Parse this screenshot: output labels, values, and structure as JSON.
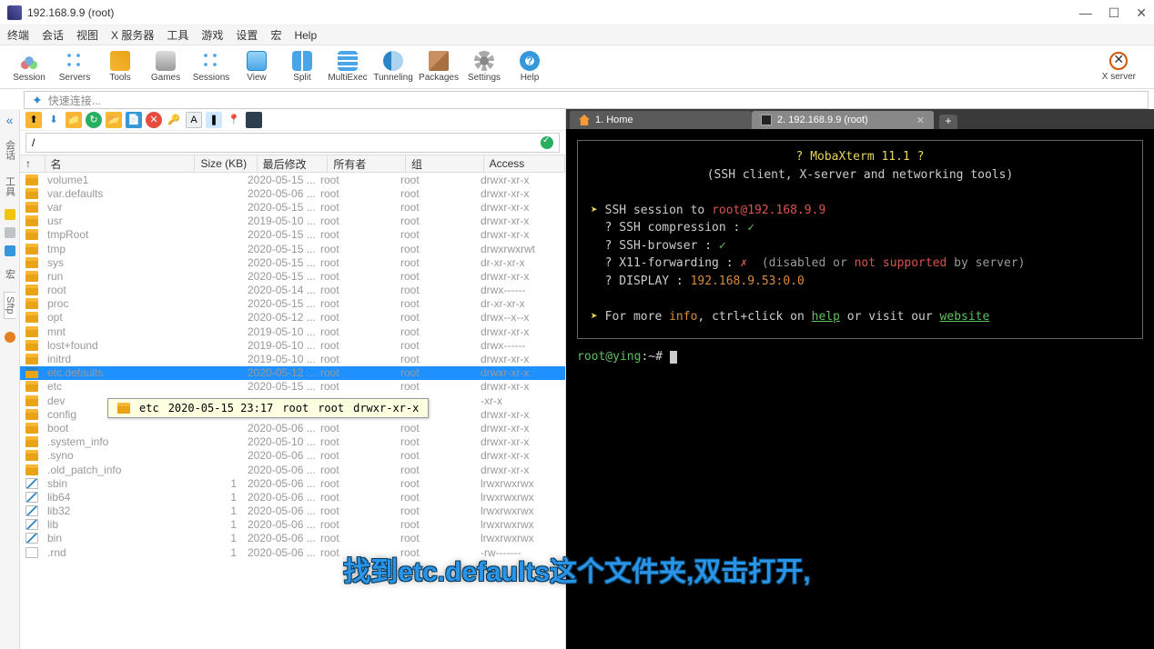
{
  "window": {
    "title": "192.168.9.9 (root)",
    "min": "—",
    "max": "☐",
    "close": "✕"
  },
  "menu": [
    "终端",
    "会话",
    "视图",
    "X 服务器",
    "工具",
    "游戏",
    "设置",
    "宏",
    "Help"
  ],
  "toolbar": [
    {
      "label": "Session",
      "icon": "ic-session"
    },
    {
      "label": "Servers",
      "icon": "ic-servers"
    },
    {
      "label": "Tools",
      "icon": "ic-tools"
    },
    {
      "label": "Games",
      "icon": "ic-games"
    },
    {
      "label": "Sessions",
      "icon": "ic-sessions"
    },
    {
      "label": "View",
      "icon": "ic-view"
    },
    {
      "label": "Split",
      "icon": "ic-split"
    },
    {
      "label": "MultiExec",
      "icon": "ic-multi"
    },
    {
      "label": "Tunneling",
      "icon": "ic-tunnel"
    },
    {
      "label": "Packages",
      "icon": "ic-pkg"
    },
    {
      "label": "Settings",
      "icon": "ic-settings"
    },
    {
      "label": "Help",
      "icon": "ic-help"
    }
  ],
  "xserver_label": "X server",
  "quick_connect_placeholder": "快速连接...",
  "sidetabs": {
    "sessions": "会话",
    "tools": "工具",
    "macros": "宏",
    "sftp": "Sftp"
  },
  "path": "/",
  "cols": {
    "name": "名",
    "size": "Size (KB)",
    "date": "最后修改",
    "owner": "所有者",
    "group": "组",
    "access": "Access"
  },
  "files": [
    {
      "icon": "fi-folder",
      "name": "volume1",
      "size": "",
      "date": "2020-05-15 ...",
      "owner": "root",
      "group": "root",
      "access": "drwxr-xr-x"
    },
    {
      "icon": "fi-folder",
      "name": "var.defaults",
      "size": "",
      "date": "2020-05-06 ...",
      "owner": "root",
      "group": "root",
      "access": "drwxr-xr-x"
    },
    {
      "icon": "fi-folder",
      "name": "var",
      "size": "",
      "date": "2020-05-15 ...",
      "owner": "root",
      "group": "root",
      "access": "drwxr-xr-x"
    },
    {
      "icon": "fi-folder",
      "name": "usr",
      "size": "",
      "date": "2019-05-10 ...",
      "owner": "root",
      "group": "root",
      "access": "drwxr-xr-x"
    },
    {
      "icon": "fi-folder",
      "name": "tmpRoot",
      "size": "",
      "date": "2020-05-15 ...",
      "owner": "root",
      "group": "root",
      "access": "drwxr-xr-x"
    },
    {
      "icon": "fi-folder",
      "name": "tmp",
      "size": "",
      "date": "2020-05-15 ...",
      "owner": "root",
      "group": "root",
      "access": "drwxrwxrwt"
    },
    {
      "icon": "fi-folder",
      "name": "sys",
      "size": "",
      "date": "2020-05-15 ...",
      "owner": "root",
      "group": "root",
      "access": "dr-xr-xr-x"
    },
    {
      "icon": "fi-folder",
      "name": "run",
      "size": "",
      "date": "2020-05-15 ...",
      "owner": "root",
      "group": "root",
      "access": "drwxr-xr-x"
    },
    {
      "icon": "fi-folder",
      "name": "root",
      "size": "",
      "date": "2020-05-14 ...",
      "owner": "root",
      "group": "root",
      "access": "drwx------"
    },
    {
      "icon": "fi-folder",
      "name": "proc",
      "size": "",
      "date": "2020-05-15 ...",
      "owner": "root",
      "group": "root",
      "access": "dr-xr-xr-x"
    },
    {
      "icon": "fi-folder",
      "name": "opt",
      "size": "",
      "date": "2020-05-12 ...",
      "owner": "root",
      "group": "root",
      "access": "drwx--x--x"
    },
    {
      "icon": "fi-folder",
      "name": "mnt",
      "size": "",
      "date": "2019-05-10 ...",
      "owner": "root",
      "group": "root",
      "access": "drwxr-xr-x"
    },
    {
      "icon": "fi-folder",
      "name": "lost+found",
      "size": "",
      "date": "2019-05-10 ...",
      "owner": "root",
      "group": "root",
      "access": "drwx------"
    },
    {
      "icon": "fi-folder",
      "name": "initrd",
      "size": "",
      "date": "2019-05-10 ...",
      "owner": "root",
      "group": "root",
      "access": "drwxr-xr-x"
    },
    {
      "icon": "fi-folder-open",
      "name": "etc.defaults",
      "size": "",
      "date": "2020-05-12 ...",
      "owner": "root",
      "group": "root",
      "access": "drwxr-xr-x",
      "selected": true
    },
    {
      "icon": "fi-folder",
      "name": "etc",
      "size": "",
      "date": "2020-05-15 ...",
      "owner": "root",
      "group": "root",
      "access": "drwxr-xr-x"
    },
    {
      "icon": "fi-folder",
      "name": "dev",
      "size": "",
      "date": "",
      "owner": "",
      "group": "",
      "access": "-xr-x"
    },
    {
      "icon": "fi-folder",
      "name": "config",
      "size": "",
      "date": "2020-05-15 ...",
      "owner": "root",
      "group": "root",
      "access": "drwxr-xr-x"
    },
    {
      "icon": "fi-folder",
      "name": "boot",
      "size": "",
      "date": "2020-05-06 ...",
      "owner": "root",
      "group": "root",
      "access": "drwxr-xr-x"
    },
    {
      "icon": "fi-folder",
      "name": ".system_info",
      "size": "",
      "date": "2020-05-10 ...",
      "owner": "root",
      "group": "root",
      "access": "drwxr-xr-x"
    },
    {
      "icon": "fi-folder",
      "name": ".syno",
      "size": "",
      "date": "2020-05-06 ...",
      "owner": "root",
      "group": "root",
      "access": "drwxr-xr-x"
    },
    {
      "icon": "fi-folder",
      "name": ".old_patch_info",
      "size": "",
      "date": "2020-05-06 ...",
      "owner": "root",
      "group": "root",
      "access": "drwxr-xr-x"
    },
    {
      "icon": "fi-link",
      "name": "sbin",
      "size": "1",
      "date": "2020-05-06 ...",
      "owner": "root",
      "group": "root",
      "access": "lrwxrwxrwx"
    },
    {
      "icon": "fi-link",
      "name": "lib64",
      "size": "1",
      "date": "2020-05-06 ...",
      "owner": "root",
      "group": "root",
      "access": "lrwxrwxrwx"
    },
    {
      "icon": "fi-link",
      "name": "lib32",
      "size": "1",
      "date": "2020-05-06 ...",
      "owner": "root",
      "group": "root",
      "access": "lrwxrwxrwx"
    },
    {
      "icon": "fi-link",
      "name": "lib",
      "size": "1",
      "date": "2020-05-06 ...",
      "owner": "root",
      "group": "root",
      "access": "lrwxrwxrwx"
    },
    {
      "icon": "fi-link",
      "name": "bin",
      "size": "1",
      "date": "2020-05-06 ...",
      "owner": "root",
      "group": "root",
      "access": "lrwxrwxrwx"
    },
    {
      "icon": "fi-file",
      "name": ".rnd",
      "size": "1",
      "date": "2020-05-06 ...",
      "owner": "root",
      "group": "root",
      "access": "-rw-------"
    }
  ],
  "tooltip": {
    "name": "etc",
    "date": "2020-05-15 23:17",
    "owner": "root",
    "group": "root",
    "access": "drwxr-xr-x"
  },
  "tabs": {
    "home": "1. Home",
    "active": "2. 192.168.9.9 (root)",
    "close": "✕",
    "plus": "+"
  },
  "term": {
    "banner1": "? MobaXterm 11.1 ?",
    "banner2": "(SSH client, X-server and networking tools)",
    "ssh_session": "SSH session to ",
    "ssh_target": "root@192.168.9.9",
    "compression": "? SSH compression : ",
    "browser": "? SSH-browser     : ",
    "x11": "? X11-forwarding  : ",
    "x11_note": "  (disabled or not supported by server)",
    "x11_word_not": "not supported",
    "display": "? DISPLAY         : ",
    "display_val": "192.168.9.53:0.0",
    "footer_pre": "For more ",
    "footer_info": "info",
    "footer_mid": ", ctrl+click on ",
    "footer_help": "help",
    "footer_mid2": " or visit our ",
    "footer_site": "website",
    "prompt_user": "root@ying",
    "prompt_sep": ":~# ",
    "check": "✓",
    "cross": "✗",
    "arrow": "➤"
  },
  "subtitle": "找到etc.defaults这个文件夹,双击打开,"
}
